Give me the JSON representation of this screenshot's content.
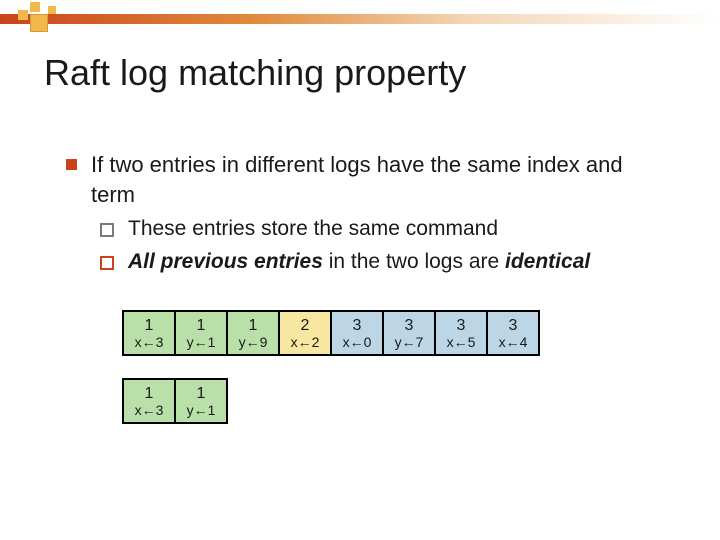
{
  "title": "Raft log matching property",
  "bullets": {
    "main": "If two entries in different logs have the same index and term",
    "sub1": "These entries store the same command",
    "sub2_a": "All previous entries",
    "sub2_b": " in the two logs are ",
    "sub2_c": "identical"
  },
  "logs": {
    "row1": [
      {
        "term": "1",
        "cmd": "x←3",
        "color": "green"
      },
      {
        "term": "1",
        "cmd": "y←1",
        "color": "green"
      },
      {
        "term": "1",
        "cmd": "y←9",
        "color": "green"
      },
      {
        "term": "2",
        "cmd": "x←2",
        "color": "yellow"
      },
      {
        "term": "3",
        "cmd": "x←0",
        "color": "blue"
      },
      {
        "term": "3",
        "cmd": "y←7",
        "color": "blue"
      },
      {
        "term": "3",
        "cmd": "x←5",
        "color": "blue"
      },
      {
        "term": "3",
        "cmd": "x←4",
        "color": "blue"
      }
    ],
    "row2": [
      {
        "term": "1",
        "cmd": "x←3",
        "color": "green"
      },
      {
        "term": "1",
        "cmd": "y←1",
        "color": "green"
      }
    ]
  }
}
